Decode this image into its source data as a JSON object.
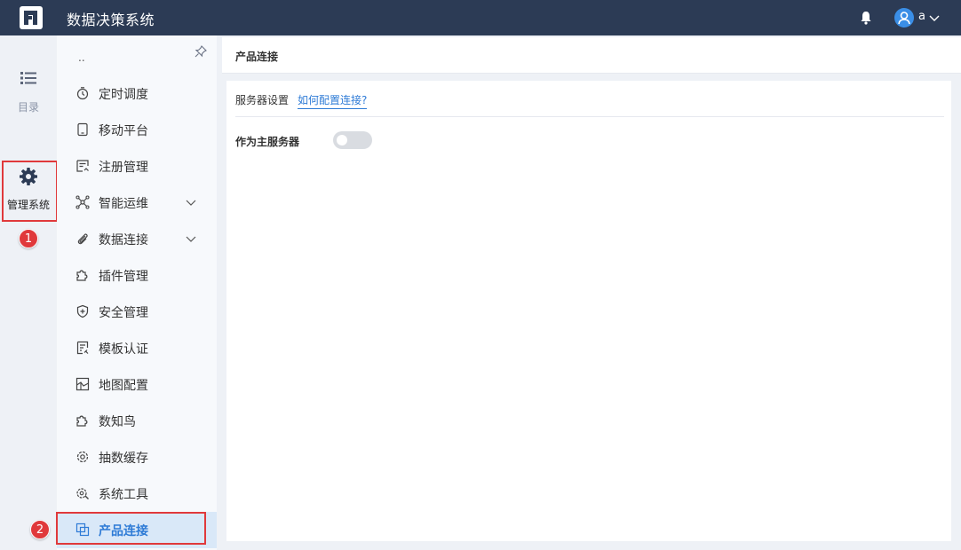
{
  "header": {
    "app_title": "数据决策系统",
    "user_name": "a",
    "icons": [
      "logo",
      "bell-icon",
      "user-avatar-icon",
      "chevron-down-icon"
    ]
  },
  "rail": {
    "items": [
      {
        "label": "目录",
        "icon": "list-icon"
      },
      {
        "label": "管理系统",
        "icon": "gear-icon",
        "active": true
      }
    ]
  },
  "annotations": {
    "badge1": "1",
    "badge2": "2",
    "color": "#e0393b"
  },
  "sidebar": {
    "dots": "..",
    "items": [
      {
        "label": "定时调度",
        "icon": "timer-icon"
      },
      {
        "label": "移动平台",
        "icon": "mobile-icon"
      },
      {
        "label": "注册管理",
        "icon": "register-icon"
      },
      {
        "label": "智能运维",
        "icon": "network-icon",
        "expandable": true
      },
      {
        "label": "数据连接",
        "icon": "paperclip-icon",
        "expandable": true
      },
      {
        "label": "插件管理",
        "icon": "puzzle-icon"
      },
      {
        "label": "安全管理",
        "icon": "shield-icon"
      },
      {
        "label": "模板认证",
        "icon": "template-icon"
      },
      {
        "label": "地图配置",
        "icon": "map-icon"
      },
      {
        "label": "数知鸟",
        "icon": "puzzle-icon"
      },
      {
        "label": "抽数缓存",
        "icon": "cache-gear-icon"
      },
      {
        "label": "系统工具",
        "icon": "tools-icon"
      },
      {
        "label": "产品连接",
        "icon": "product-link-icon",
        "active": true
      }
    ]
  },
  "main": {
    "tab_title": "产品连接",
    "server_settings_label": "服务器设置",
    "config_link": "如何配置连接?",
    "master_server_label": "作为主服务器",
    "master_server_enabled": false
  },
  "colors": {
    "header_bg": "#2c3b55",
    "accent": "#2e7bd6",
    "active_menu_bg": "#d9e8f8"
  }
}
